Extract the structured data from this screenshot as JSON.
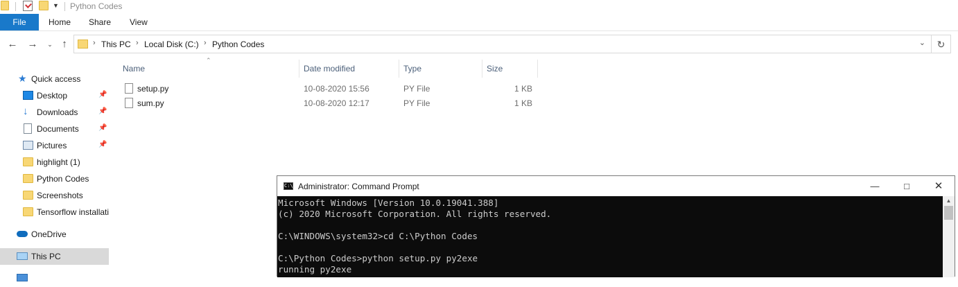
{
  "window": {
    "title": "Python Codes"
  },
  "ribbon": {
    "tabs": [
      "File",
      "Home",
      "Share",
      "View"
    ]
  },
  "address": {
    "crumbs": [
      "This PC",
      "Local Disk (C:)",
      "Python Codes"
    ]
  },
  "sidebar": {
    "items": [
      {
        "label": "Quick access",
        "icon": "star-icon",
        "pinned": false
      },
      {
        "label": "Desktop",
        "icon": "desktop-icon",
        "pinned": true
      },
      {
        "label": "Downloads",
        "icon": "download-icon",
        "pinned": true
      },
      {
        "label": "Documents",
        "icon": "documents-icon",
        "pinned": true
      },
      {
        "label": "Pictures",
        "icon": "pictures-icon",
        "pinned": true
      },
      {
        "label": "highlight (1)",
        "icon": "folder-icon",
        "pinned": false
      },
      {
        "label": "Python Codes",
        "icon": "folder-icon",
        "pinned": false
      },
      {
        "label": "Screenshots",
        "icon": "folder-icon",
        "pinned": false
      },
      {
        "label": "Tensorflow installati",
        "icon": "folder-icon",
        "pinned": false
      },
      {
        "label": "OneDrive",
        "icon": "cloud-icon",
        "pinned": false
      },
      {
        "label": "This PC",
        "icon": "computer-icon",
        "pinned": false,
        "selected": true
      }
    ]
  },
  "filelist": {
    "columns": [
      "Name",
      "Date modified",
      "Type",
      "Size"
    ],
    "rows": [
      {
        "name": "setup.py",
        "date": "10-08-2020 15:56",
        "type": "PY File",
        "size": "1 KB"
      },
      {
        "name": "sum.py",
        "date": "10-08-2020 12:17",
        "type": "PY File",
        "size": "1 KB"
      }
    ]
  },
  "cmd": {
    "title": "Administrator: Command Prompt",
    "icon_text": "C:\\",
    "lines": [
      "Microsoft Windows [Version 10.0.19041.388]",
      "(c) 2020 Microsoft Corporation. All rights reserved.",
      "",
      "C:\\WINDOWS\\system32>cd C:\\Python Codes",
      "",
      "C:\\Python Codes>python setup.py py2exe",
      "running py2exe"
    ]
  },
  "colors": {
    "accent": "#1979ca",
    "folder": "#f8d775",
    "console_bg": "#0c0c0c",
    "console_fg": "#cccccc"
  }
}
